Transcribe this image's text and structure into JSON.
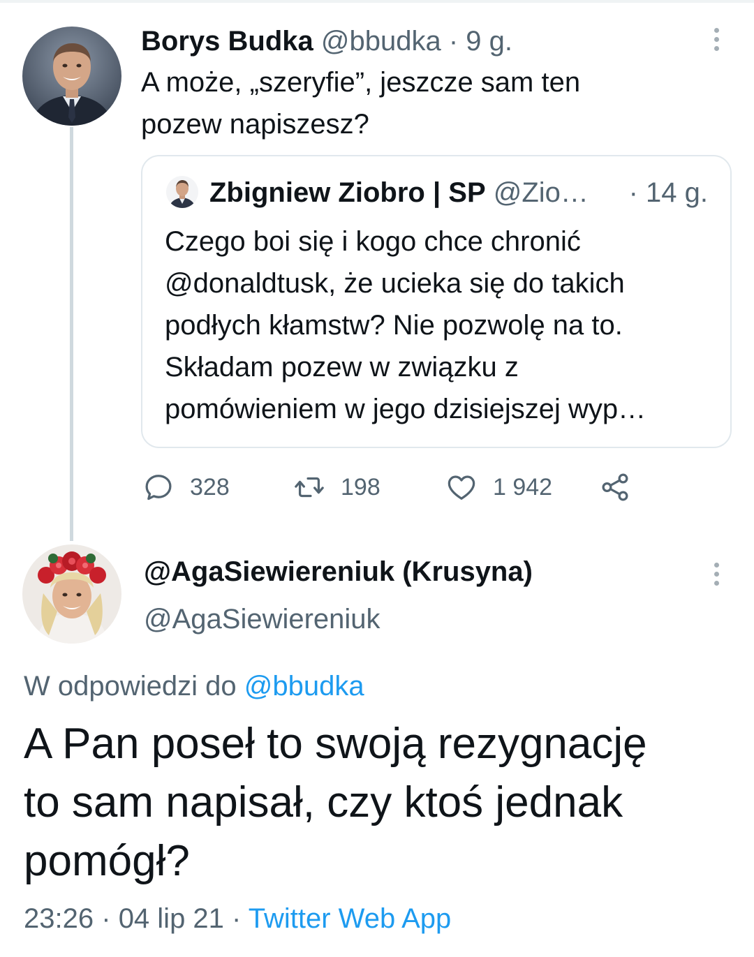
{
  "tweet1": {
    "name": "Borys Budka",
    "handle": "@bbudka",
    "separator": "·",
    "time": "9 g.",
    "text_lines": [
      "A może, „szeryfie”, jeszcze sam ten",
      "pozew napiszesz?"
    ],
    "avatar_icon": "person-portrait-suit",
    "more_icon": "more-vertical-icon"
  },
  "quoted_tweet": {
    "name": "Zbigniew Ziobro | SP",
    "handle_truncated": "@Zio…",
    "time": "· 14 g.",
    "text_lines": [
      "Czego boi się i kogo chce chronić",
      "@donaldtusk, że ucieka się do takich",
      "podłych kłamstw? Nie pozwolę na to.",
      "Składam pozew w związku z",
      "pomówieniem w jego dzisiejszej wyp…"
    ]
  },
  "actions": {
    "replies": "328",
    "retweets": "198",
    "likes": "1 942",
    "icons": [
      "reply-icon",
      "retweet-icon",
      "like-icon",
      "share-icon"
    ]
  },
  "tweet2": {
    "name": "@AgaSiewiereniuk (Krusyna)",
    "handle": "@AgaSiewiereniuk",
    "reply_prefix": "W odpowiedzi do",
    "reply_to": "@bbudka",
    "text_lines": [
      "A Pan poseł to swoją rezygnację",
      "to sam napisał, czy ktoś jednak",
      "pomógł?"
    ],
    "time": "23:26",
    "date": "04 lip 21",
    "separator": "·",
    "source": "Twitter Web App",
    "avatar_icon": "person-portrait-flower-wreath"
  },
  "colors": {
    "link": "#1d9bf0",
    "muted": "#536471",
    "text": "#0f1419",
    "border": "#e1e8ed",
    "thread_line": "#cfd9de"
  }
}
